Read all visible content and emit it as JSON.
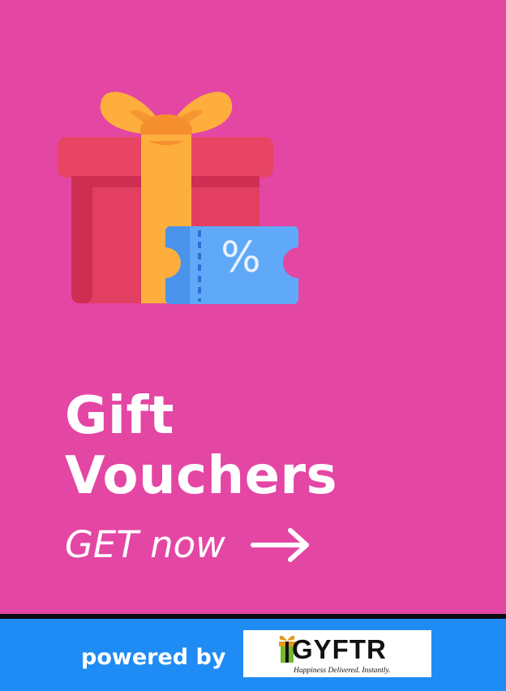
{
  "promo": {
    "title_line1": "Gift",
    "title_line2": "Vouchers",
    "cta_label": "GET now",
    "illustration": {
      "icon": "gift-box-with-discount-voucher-icon",
      "voucher_symbol": "%"
    },
    "background_color": "#E446A4"
  },
  "footer": {
    "powered_by_label": "powered by",
    "background_color": "#1F8CF5",
    "logo": {
      "name": "GYFTR",
      "tagline": "Happiness Delivered. Instantly."
    }
  }
}
